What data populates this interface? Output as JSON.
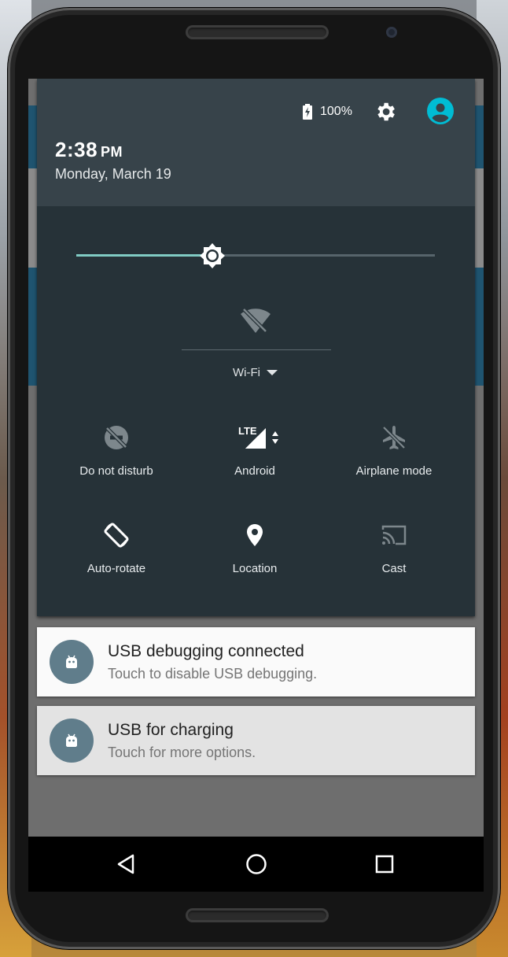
{
  "status": {
    "battery_percent": "100%"
  },
  "header": {
    "time": "2:38",
    "ampm": "PM",
    "date": "Monday, March 19"
  },
  "brightness": {
    "level": 0.38
  },
  "wifi": {
    "label": "Wi-Fi"
  },
  "tiles": [
    {
      "label": "Do not disturb",
      "icon": "do-not-disturb-icon"
    },
    {
      "label": "Android",
      "icon": "lte-signal-icon",
      "badge": "LTE"
    },
    {
      "label": "Airplane mode",
      "icon": "airplane-icon"
    },
    {
      "label": "Auto-rotate",
      "icon": "auto-rotate-icon"
    },
    {
      "label": "Location",
      "icon": "location-pin-icon"
    },
    {
      "label": "Cast",
      "icon": "cast-icon"
    }
  ],
  "notifications": [
    {
      "title": "USB debugging connected",
      "text": "Touch to disable USB debugging.",
      "icon": "android-icon"
    },
    {
      "title": "USB for charging",
      "text": "Touch for more options.",
      "icon": "android-icon"
    }
  ],
  "colors": {
    "shade": "#263238",
    "header": "#37434a",
    "accent": "#80cbc4",
    "avatar": "#00bcd4",
    "notif_icon": "#607d8b"
  }
}
